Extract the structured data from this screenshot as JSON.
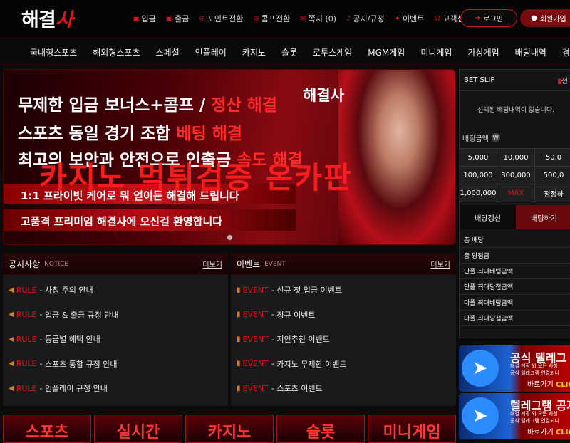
{
  "brand": {
    "logo_main": "해결",
    "logo_x": "사"
  },
  "topnav": [
    {
      "label": "입금",
      "icon": "deposit-icon"
    },
    {
      "label": "출금",
      "icon": "withdraw-icon"
    },
    {
      "label": "포인트전환",
      "icon": "point-icon"
    },
    {
      "label": "콤프전환",
      "icon": "comp-icon"
    },
    {
      "label": "쪽지 (0)",
      "icon": "message-icon"
    },
    {
      "label": "공지/규정",
      "icon": "bell-icon"
    },
    {
      "label": "이벤트",
      "icon": "gift-icon"
    },
    {
      "label": "고객센터",
      "icon": "headset-icon"
    }
  ],
  "auth": {
    "login": "로그인",
    "join": "회원가입"
  },
  "mainnav": [
    "국내형스포츠",
    "해외형스포츠",
    "스페셜",
    "인플레이",
    "카지노",
    "슬롯",
    "로투스게임",
    "MGM게임",
    "미니게임",
    "가상게임",
    "배팅내역",
    "경기결과"
  ],
  "banner": {
    "logo": "해결사",
    "line1_white": "무제한 입금 보너스+콤프 / ",
    "line1_red": "정산 해결",
    "line2_white": "스포츠 동일 경기 조합 ",
    "line2_red": "베팅 해결",
    "line3_white": "최고의 보안과 안전으로 인출금 ",
    "line3_red": "속도 해결",
    "line4": "1:1 프라이빗 케어로 뭐 얻이든 해결해 드립니다",
    "line5": "고품격 프리미엄 해결사에 오신걸 환영합니다",
    "watermark": "카지노 먹튀검증 온카판"
  },
  "notice": {
    "title": "공지사항",
    "subtitle": "NOTICE",
    "more": "더보기",
    "items": [
      {
        "tag": "RULE",
        "text": "사칭 주의 안내"
      },
      {
        "tag": "RULE",
        "text": "입금 & 출금 규정 안내"
      },
      {
        "tag": "RULE",
        "text": "등급별 혜택 안내"
      },
      {
        "tag": "RULE",
        "text": "스포츠 통합 규정 안내"
      },
      {
        "tag": "RULE",
        "text": "인플레이 규정 안내"
      }
    ]
  },
  "event": {
    "title": "이벤트",
    "subtitle": "EVENT",
    "more": "더보기",
    "items": [
      {
        "tag": "EVENT",
        "text": "신규 첫 입금 이벤트"
      },
      {
        "tag": "EVENT",
        "text": "정규 이벤트"
      },
      {
        "tag": "EVENT",
        "text": "지인추천 이벤트"
      },
      {
        "tag": "EVENT",
        "text": "카지노 무제한 이벤트"
      },
      {
        "tag": "EVENT",
        "text": "스포츠 이벤트"
      }
    ]
  },
  "betslip": {
    "title": "BET SLIP",
    "top_right": "전",
    "empty": "선택된 배팅내역이 없습니다.",
    "amount_label": "배팅금액",
    "amounts": [
      "5,000",
      "10,000",
      "50,0",
      "100,000",
      "300,000",
      "500,0",
      "1,000,000",
      "MAX",
      "정정하"
    ],
    "btn_refresh": "배당갱신",
    "btn_bet": "배팅하기",
    "summary": [
      "총 배당",
      "총 당첨금",
      "단폴 최대베팅금액",
      "단폴 최대당첨금액",
      "다폴 최대베팅금액",
      "다폴 최대당첨금액"
    ]
  },
  "promos": [
    {
      "title": "공식 텔레그",
      "small1": "해결 계정 외 모든 사칭",
      "small2": "공식 텔레그램 연결되니",
      "cta": "바로가기",
      "cta2": "CLICK"
    },
    {
      "title": "텔레그램 공지",
      "small1": "해결 계정 외 모든 사칭",
      "small2": "공식 텔레그램 연결되니",
      "cta": "바로가기",
      "cta2": "CLICK"
    }
  ],
  "categories": [
    "스포츠",
    "실시간",
    "카지노",
    "슬롯",
    "미니게임"
  ],
  "colors": {
    "accent": "#e0121a",
    "bg": "#0b0b0d",
    "panel": "#1a1a1c"
  }
}
